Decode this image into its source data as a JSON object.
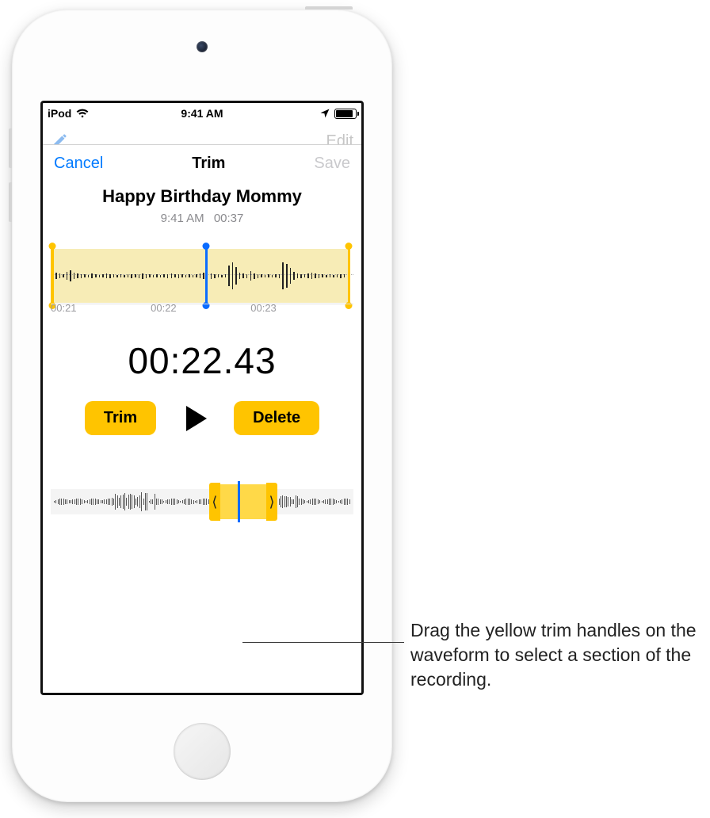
{
  "status": {
    "carrier": "iPod",
    "time": "9:41 AM"
  },
  "behind": {
    "edit_label": "Edit"
  },
  "nav": {
    "cancel": "Cancel",
    "title": "Trim",
    "save": "Save"
  },
  "recording": {
    "title": "Happy Birthday Mommy",
    "time": "9:41 AM",
    "duration": "00:37"
  },
  "zoom": {
    "ticks": [
      "00:21",
      "00:22",
      "00:23"
    ]
  },
  "timecode": "00:22.43",
  "controls": {
    "trim": "Trim",
    "delete": "Delete"
  },
  "overview_handles": {
    "left_glyph": "⟨",
    "right_glyph": "⟩"
  },
  "callout": "Drag the yellow trim handles on the waveform to select a section of the recording."
}
